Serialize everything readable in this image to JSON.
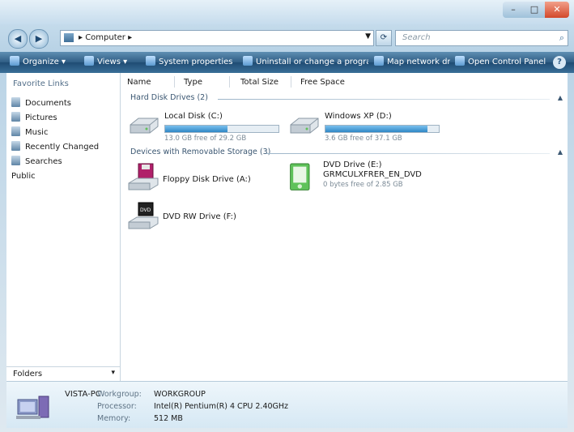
{
  "window": {
    "controls": {
      "minimize": "–",
      "maximize": "□",
      "close": "✕"
    }
  },
  "address": {
    "path": "▸ Computer ▸",
    "search_placeholder": "Search"
  },
  "toolbar": {
    "items": [
      "Organize ▾",
      "Views ▾",
      "System properties",
      "Uninstall or change a program",
      "Map network drive",
      "Open Control Panel"
    ],
    "help": "?"
  },
  "nav": {
    "heading": "Favorite Links",
    "items": [
      "Documents",
      "Pictures",
      "Music",
      "Recently Changed",
      "Searches",
      "Public"
    ],
    "folders_label": "Folders"
  },
  "content": {
    "columns": [
      "Name",
      "Type",
      "Total Size",
      "Free Space"
    ],
    "groups": {
      "hdd": "Hard Disk Drives (2)",
      "removable": "Devices with Removable Storage (3)"
    },
    "drives": [
      {
        "name": "Local Disk (C:)",
        "free": "13.0 GB free of 29.2 GB",
        "used_fraction": 0.55
      },
      {
        "name": "Windows XP (D:)",
        "free": "3.6 GB free of 37.1 GB",
        "used_fraction": 0.9
      }
    ],
    "devices": [
      {
        "name": "Floppy Disk Drive (A:)"
      },
      {
        "name": "DVD Drive (E:)",
        "sub1": "GRMCULXFRER_EN_DVD",
        "sub2": "0 bytes free of 2.85 GB"
      },
      {
        "name": "DVD RW Drive (F:)"
      }
    ]
  },
  "details": {
    "computer_name": "VISTA-PC",
    "rows": [
      {
        "label": "Workgroup:",
        "value": "WORKGROUP"
      },
      {
        "label": "Processor:",
        "value": "Intel(R) Pentium(R) 4 CPU 2.40GHz"
      },
      {
        "label": "Memory:",
        "value": "512 MB"
      }
    ]
  },
  "colors": {
    "toolbar": "#2f5d84",
    "accent": "#2f87c6"
  }
}
